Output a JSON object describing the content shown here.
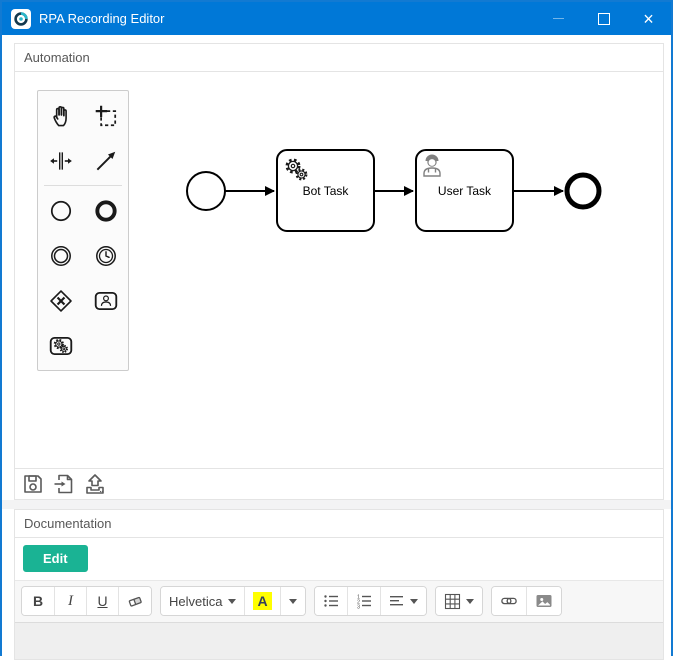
{
  "window": {
    "title": "RPA Recording Editor",
    "close_glyph": "×",
    "titlebar_color": "#0078d7"
  },
  "automation_panel": {
    "title": "Automation",
    "footer_icons": [
      "save",
      "import",
      "export"
    ]
  },
  "palette": {
    "icons": [
      "hand-tool",
      "lasso-tool",
      "space-tool",
      "global-connect-tool",
      "start-event",
      "end-event",
      "intermediate-event",
      "timer-event",
      "gateway",
      "user-task",
      "bot-task"
    ]
  },
  "diagram": {
    "nodes": [
      {
        "type": "start-event"
      },
      {
        "type": "bot-task",
        "label": "Bot Task"
      },
      {
        "type": "user-task",
        "label": "User Task"
      },
      {
        "type": "end-event"
      }
    ],
    "flows": [
      {
        "from": "start-event",
        "to": "bot-task"
      },
      {
        "from": "bot-task",
        "to": "user-task"
      },
      {
        "from": "user-task",
        "to": "end-event"
      }
    ]
  },
  "documentation_panel": {
    "title": "Documentation",
    "edit_button": "Edit",
    "toolbar": {
      "bold": "B",
      "italic": "I",
      "underline": "U",
      "font_family": "Helvetica",
      "color_letter": "A",
      "icons": [
        "clear-format",
        "font-dropdown",
        "color",
        "color-caret",
        "unordered-list",
        "ordered-list",
        "paragraph-align",
        "table",
        "link",
        "picture"
      ]
    },
    "text_content": ""
  },
  "colors": {
    "titlebar": "#0078d7",
    "edit_button": "#1ab394",
    "color_highlight": "#ffff00"
  }
}
